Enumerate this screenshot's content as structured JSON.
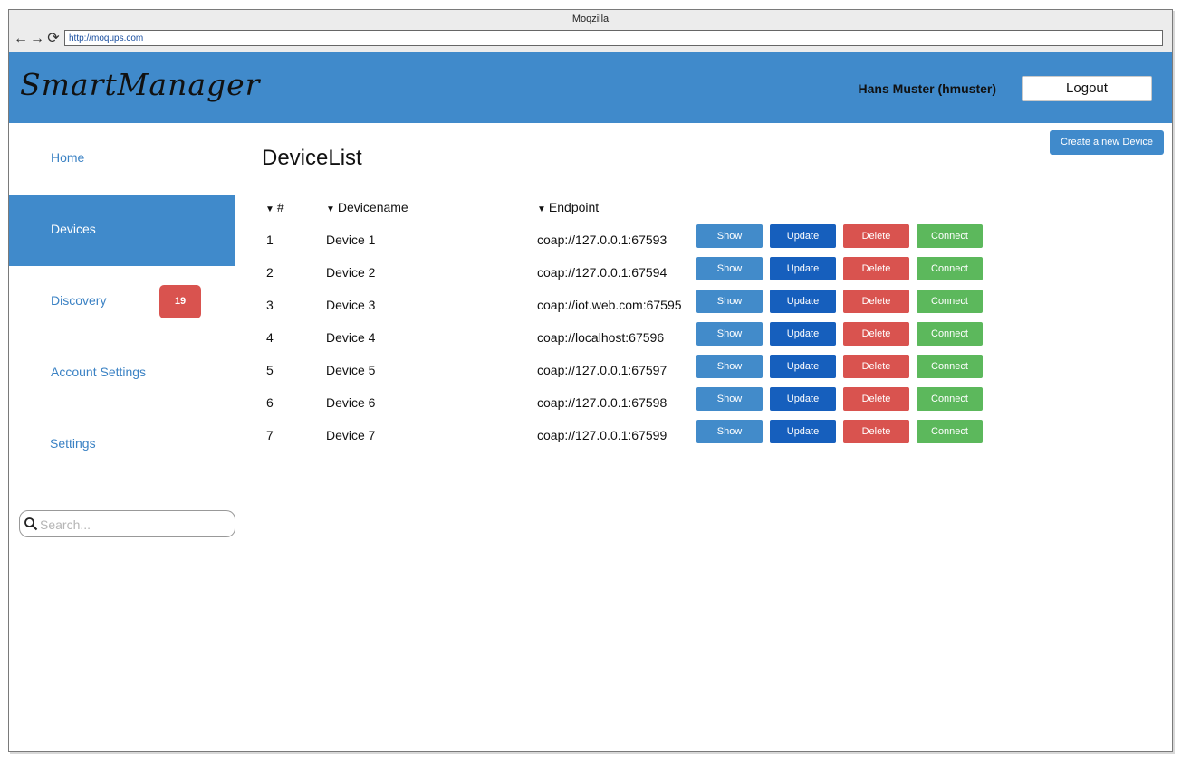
{
  "browser": {
    "title": "Moqzilla",
    "url": "http://moqups.com",
    "back_icon": "←",
    "forward_icon": "→",
    "reload_icon": "⟳"
  },
  "header": {
    "logo": "SmartManager",
    "user": "Hans Muster (hmuster)",
    "logout_label": "Logout"
  },
  "sidebar": {
    "items": [
      {
        "label": "Home",
        "active": false
      },
      {
        "label": "Devices",
        "active": true
      },
      {
        "label": "Discovery",
        "active": false,
        "badge": "19"
      },
      {
        "label": "Account Settings",
        "active": false
      },
      {
        "label": "Settings",
        "active": false
      }
    ],
    "search_placeholder": "Search..."
  },
  "main": {
    "title": "DeviceList",
    "create_label": "Create a new Device",
    "sort_icon": "▼",
    "columns": [
      "#",
      "Devicename",
      "Endpoint"
    ],
    "actions": [
      "Show",
      "Update",
      "Delete",
      "Connect"
    ],
    "rows": [
      {
        "id": "1",
        "name": "Device 1",
        "endpoint": "coap://127.0.0.1:67593"
      },
      {
        "id": "2",
        "name": "Device 2",
        "endpoint": "coap://127.0.0.1:67594"
      },
      {
        "id": "3",
        "name": "Device 3",
        "endpoint": "coap://iot.web.com:67595"
      },
      {
        "id": "4",
        "name": "Device 4",
        "endpoint": "coap://localhost:67596"
      },
      {
        "id": "5",
        "name": "Device 5",
        "endpoint": "coap://127.0.0.1:67597"
      },
      {
        "id": "6",
        "name": "Device 6",
        "endpoint": "coap://127.0.0.1:67598"
      },
      {
        "id": "7",
        "name": "Device 7",
        "endpoint": "coap://127.0.0.1:67599"
      }
    ]
  },
  "colors": {
    "primary": "#408acb",
    "update": "#165fbd",
    "delete": "#d9534f",
    "connect": "#5cb85c"
  }
}
